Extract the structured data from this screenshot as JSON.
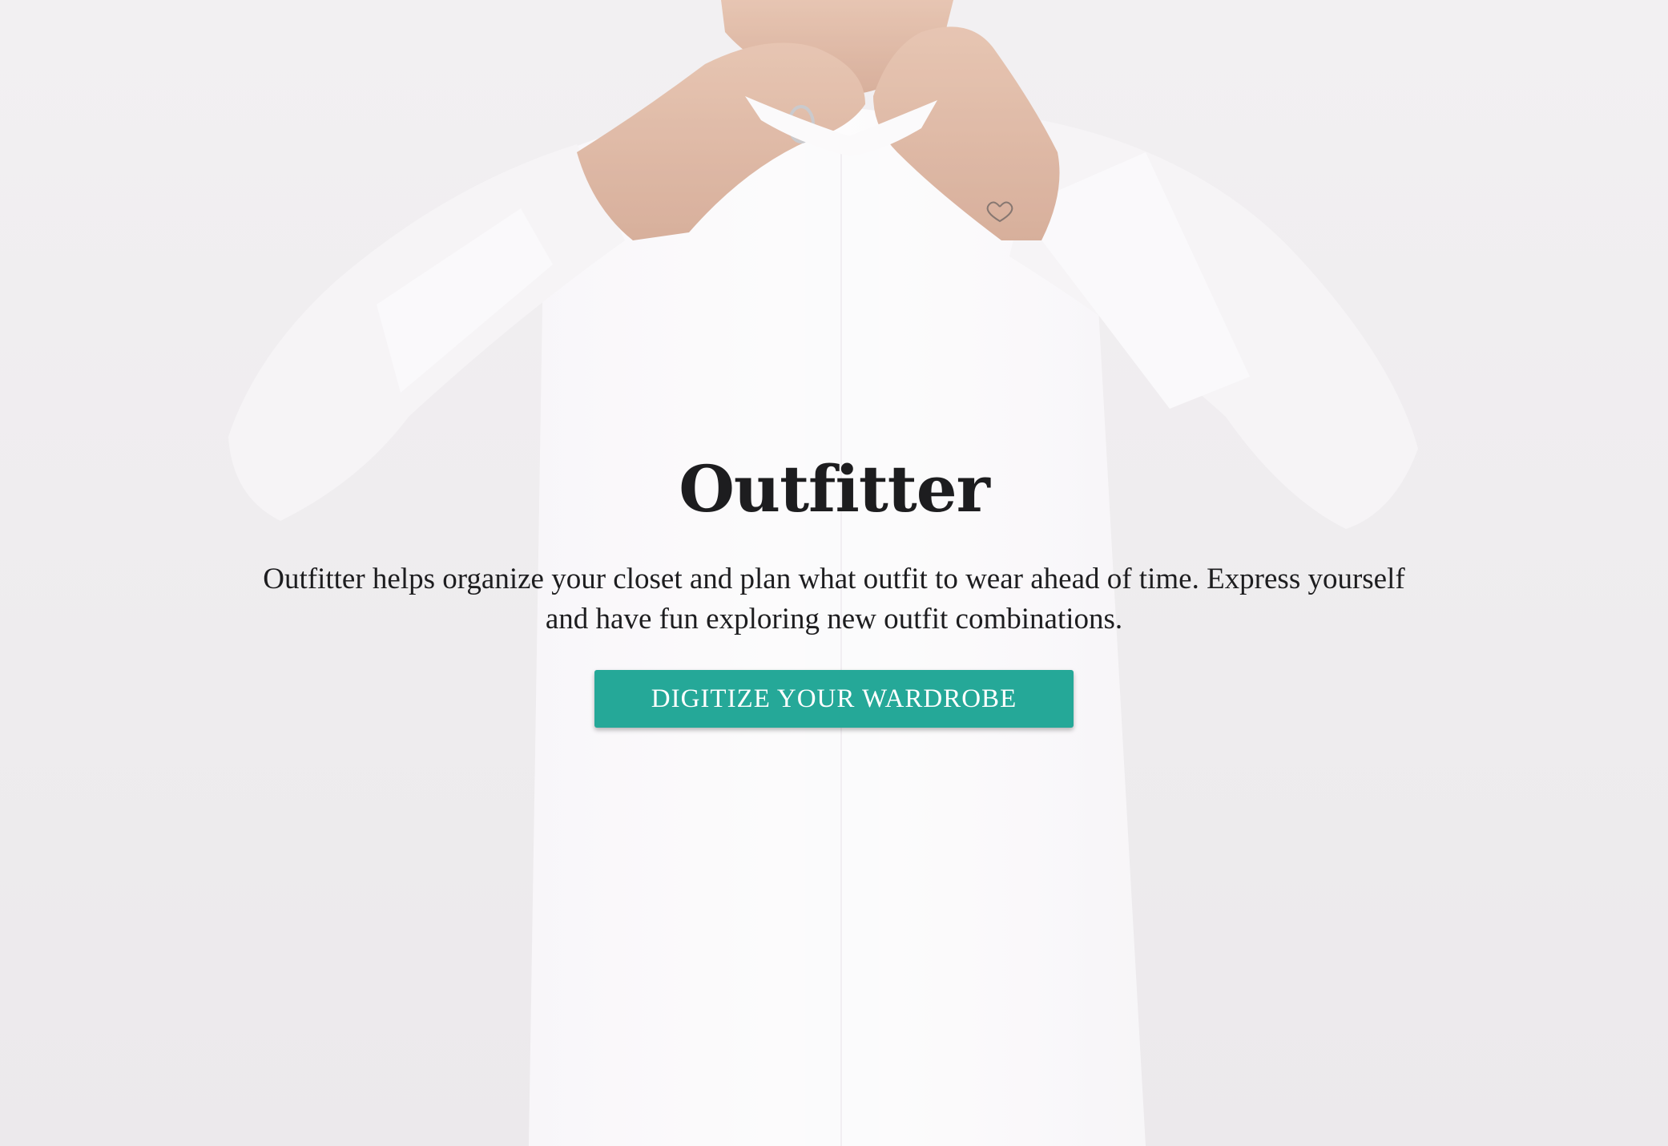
{
  "hero": {
    "title": "Outfitter",
    "tagline": "Outfitter helps organize your closet and plan what outfit to wear ahead of time. Express yourself and have fun exploring new outfit combinations.",
    "cta_label": "DIGITIZE YOUR WARDROBE"
  },
  "colors": {
    "accent": "#25a898",
    "background": "#ece9ec",
    "text": "#1d1d1f"
  },
  "icons": {
    "background_image": "man-buttoning-white-shirt-photo"
  }
}
